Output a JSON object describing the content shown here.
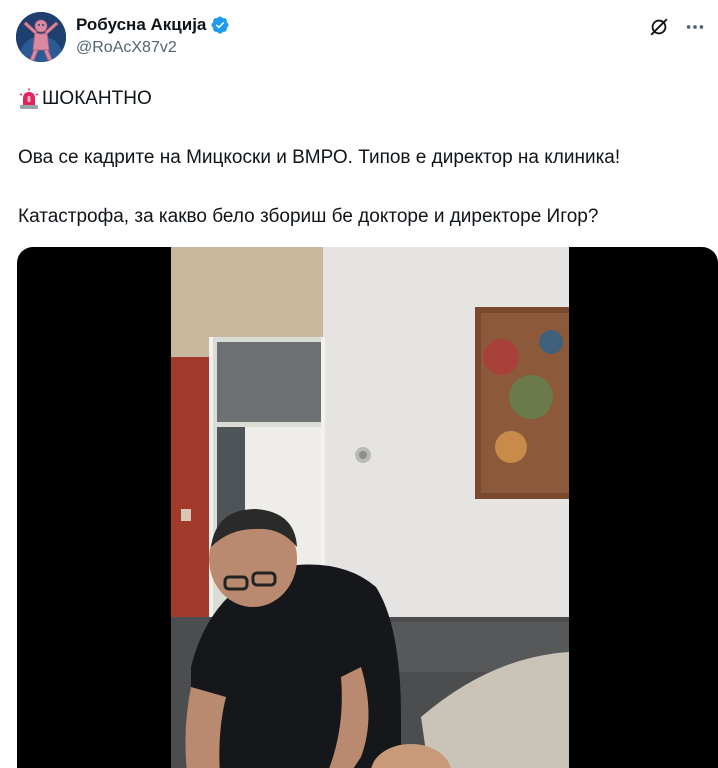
{
  "author": {
    "display_name": "Робусна Акција",
    "handle": "@RoAcX87v2",
    "verified": true,
    "verified_color": "#1d9bf0",
    "avatar_bg": "#1f3f6e",
    "avatar_figure_color": "#d98aa0"
  },
  "actions": {
    "grok_icon": "grok-icon",
    "more_icon": "more-icon"
  },
  "tweet": {
    "heading_icon": "siren-icon",
    "heading": "ШОКАНТНО",
    "paragraph1": "Ова се кадрите на Мицкоски и ВМРО. Типов е директор на клиника!",
    "paragraph2": "Катастрофа, за какво бело збориш бе докторе и директоре Игор?"
  },
  "media": {
    "type": "video",
    "background": "#000000"
  }
}
